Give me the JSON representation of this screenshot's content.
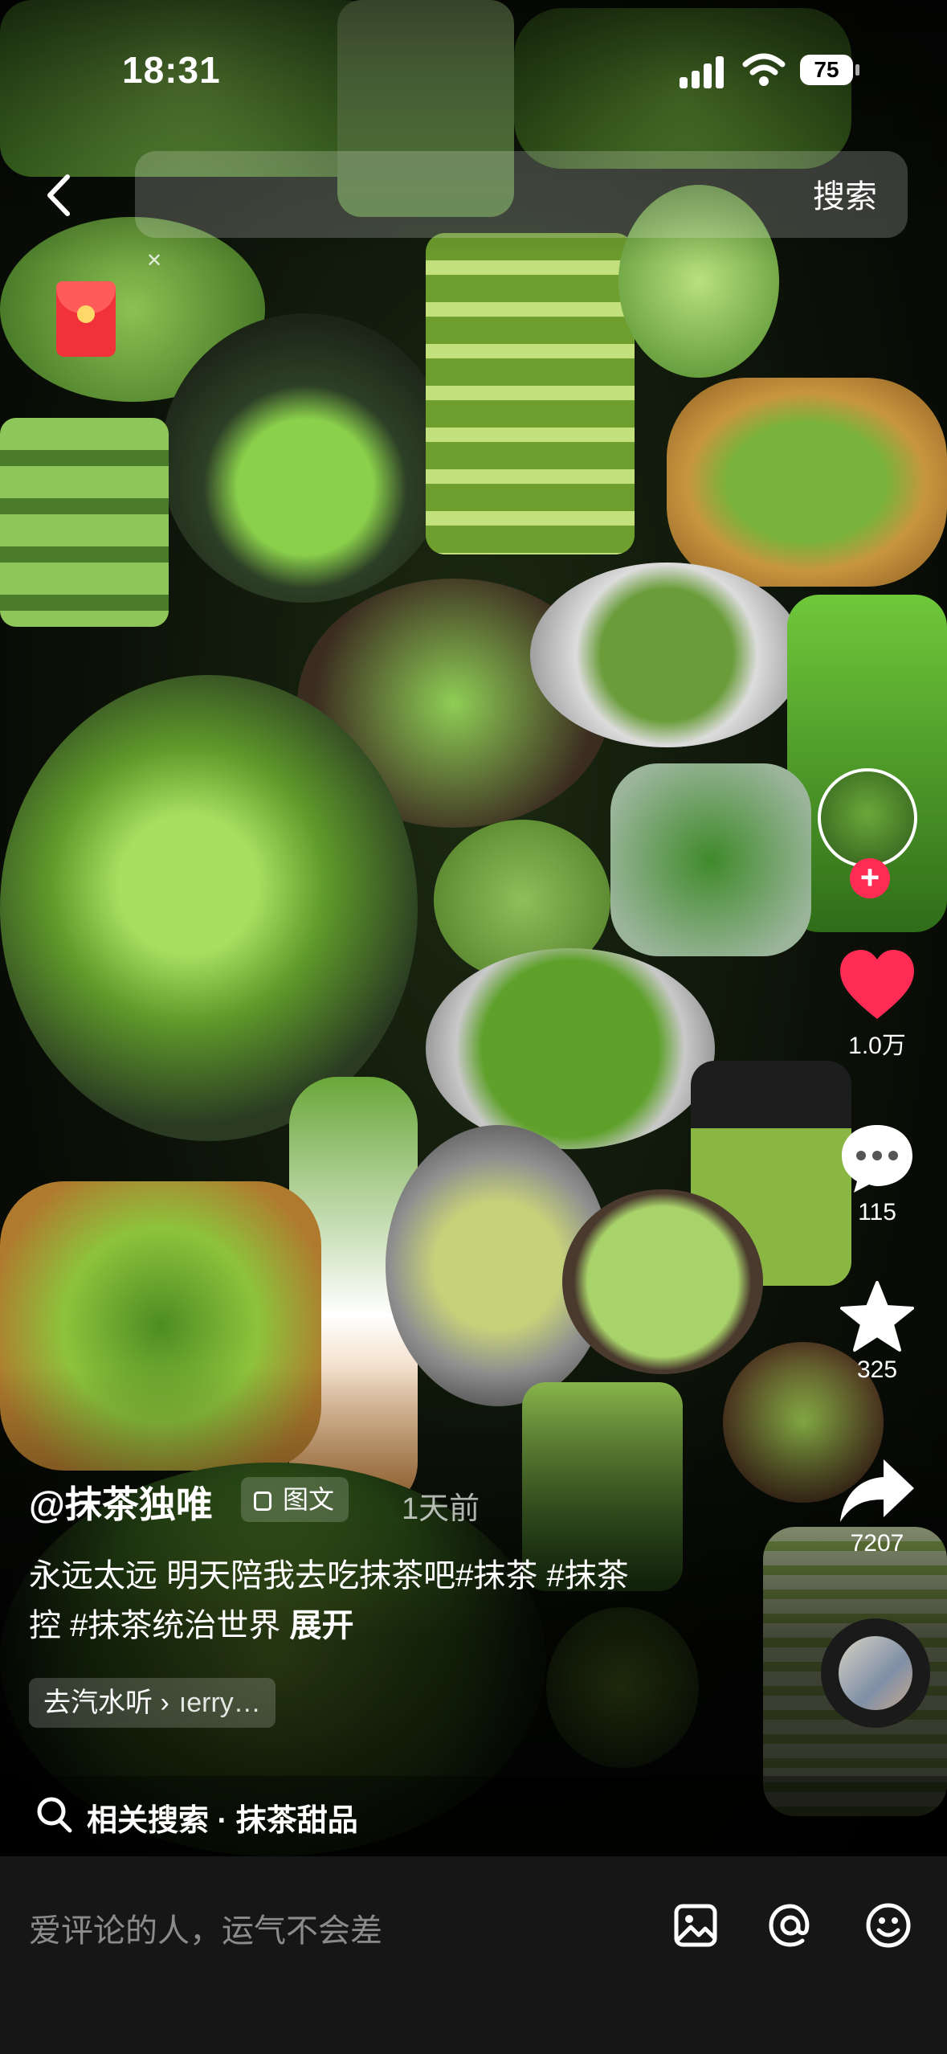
{
  "status_bar": {
    "time": "18:31",
    "battery": "75"
  },
  "search": {
    "button_label": "搜索",
    "placeholder": ""
  },
  "actions": {
    "like_count": "1.0万",
    "comment_count": "115",
    "favorite_count": "325",
    "share_count": "7207"
  },
  "post": {
    "author": "@抹茶独唯",
    "type_label": "图文",
    "time_ago": "1天前",
    "caption_line1": "永远太远 明天陪我去吃抹茶吧#抹茶 #抹茶",
    "caption_line2_prefix": "控 #抹茶统治世界  ",
    "expand_label": "展开",
    "music_prefix": "去汽水听",
    "music_name": "ıerry…"
  },
  "related_search": {
    "label": "相关搜索 · 抹茶甜品"
  },
  "comment_bar": {
    "placeholder": "爱评论的人，运气不会差"
  },
  "colors": {
    "accent_red": "#fe2c55",
    "matcha_green": "#7cb342",
    "comment_bar_bg": "#161616"
  },
  "icons": [
    "back-icon",
    "red-envelope-icon",
    "follow-plus-icon",
    "heart-icon",
    "comment-icon",
    "star-icon",
    "share-icon",
    "image-icon",
    "at-icon",
    "emoji-icon",
    "search-icon"
  ]
}
